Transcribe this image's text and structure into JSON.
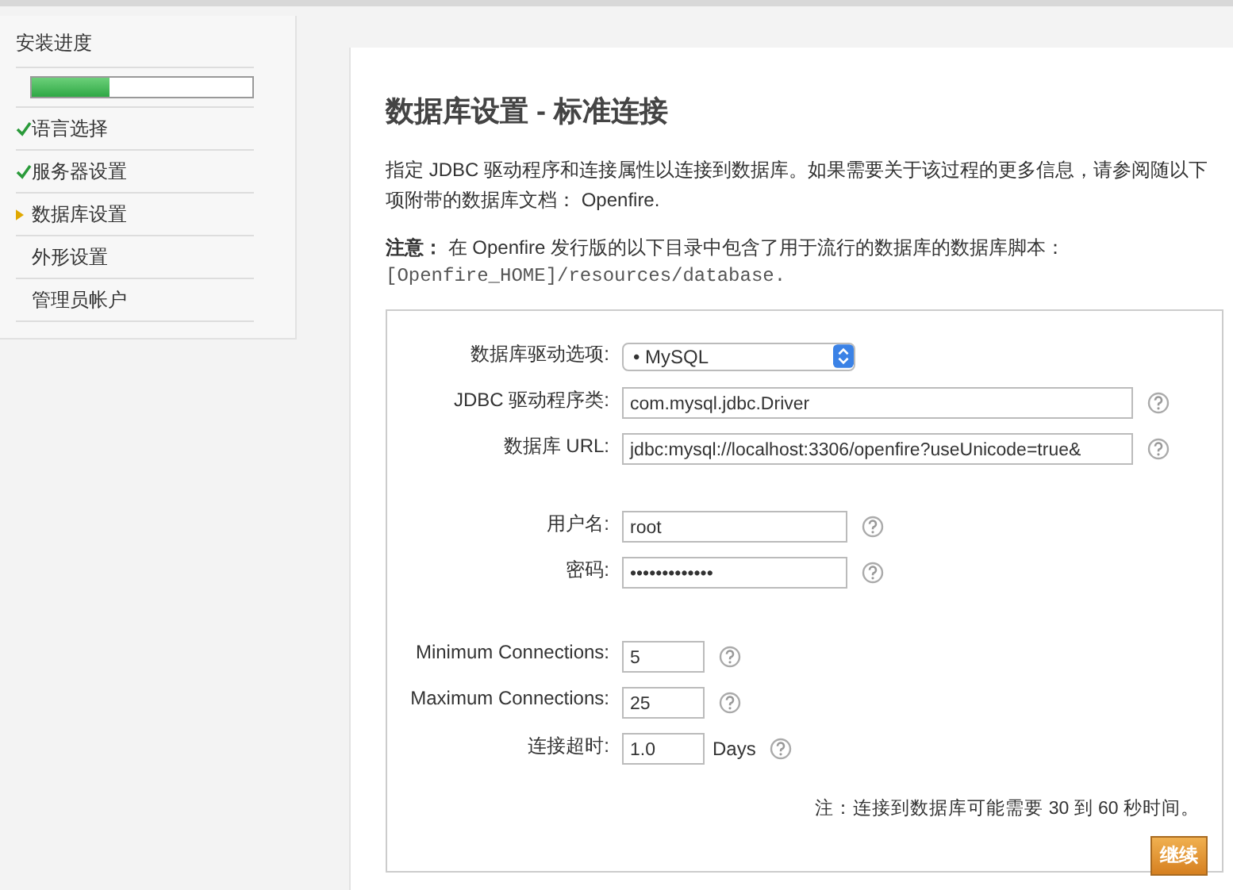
{
  "sidebar": {
    "title": "安装进度",
    "progress": {
      "level": 0.35
    },
    "steps": [
      {
        "label": "语言选择",
        "kind": "done"
      },
      {
        "label": "服务器设置",
        "kind": "done"
      },
      {
        "label": "数据库设置",
        "kind": "current"
      },
      {
        "label": "外形设置",
        "kind": "pending"
      },
      {
        "label": "管理员帐户",
        "kind": "pending"
      }
    ]
  },
  "main": {
    "title": "数据库设置 - 标准连接",
    "intro": "指定 JDBC 驱动程序和连接属性以连接到数据库。如果需要关于该过程的更多信息，请参阅随以下项附带的数据库文档： Openfire.",
    "note_label": "注意：",
    "note": "在 Openfire 发行版的以下目录中包含了用于流行的数据库的数据库脚本：",
    "note_path": "[Openfire_HOME]/resources/database.",
    "form": {
      "groups": [
        [
          {
            "label": "数据库驱动选项:",
            "kind": "select",
            "value": "• MySQL"
          },
          {
            "label": "JDBC 驱动程序类:",
            "kind": "long",
            "value": "com.mysql.jdbc.Driver",
            "help": true
          },
          {
            "label": "数据库 URL:",
            "kind": "long",
            "value": "jdbc:mysql://localhost:3306/openfire?useUnicode=true&",
            "help": true
          }
        ],
        [
          {
            "label": "用户名:",
            "kind": "medium",
            "value": "root",
            "help": true
          },
          {
            "label": "密码:",
            "kind": "password",
            "value": "•••••••••••••",
            "help": true
          }
        ],
        [
          {
            "label": "Minimum Connections:",
            "kind": "short",
            "value": "5",
            "help": true
          },
          {
            "label": "Maximum Connections:",
            "kind": "short",
            "value": "25",
            "help": true
          },
          {
            "label": "连接超时:",
            "kind": "short",
            "value": "1.0",
            "unit": "Days",
            "help": true
          }
        ]
      ],
      "footnote": "注：连接到数据库可能需要 30 到 60 秒时间。",
      "button": "继续"
    }
  }
}
